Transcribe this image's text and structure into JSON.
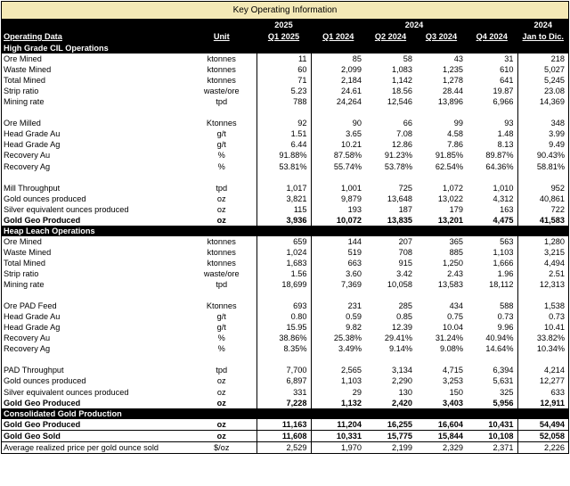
{
  "title": "Key Operating Information",
  "header": {
    "years": {
      "y2025": "2025",
      "y2024": "2024",
      "y2024b": "2024"
    },
    "col_operating": "Operating Data",
    "col_unit": "Unit",
    "periods": [
      "Q1 2025",
      "Q1 2024",
      "Q2 2024",
      "Q3 2024",
      "Q4 2024",
      "Jan to Dic."
    ]
  },
  "sections": [
    {
      "title": "High Grade CIL Operations",
      "rows": [
        {
          "label": "Ore Mined",
          "unit": "ktonnes",
          "values": [
            "11",
            "85",
            "58",
            "43",
            "31",
            "218"
          ]
        },
        {
          "label": "Waste Mined",
          "unit": "ktonnes",
          "values": [
            "60",
            "2,099",
            "1,083",
            "1,235",
            "610",
            "5,027"
          ]
        },
        {
          "label": "Total Mined",
          "unit": "ktonnes",
          "values": [
            "71",
            "2,184",
            "1,142",
            "1,278",
            "641",
            "5,245"
          ]
        },
        {
          "label": "Strip ratio",
          "unit": "waste/ore",
          "values": [
            "5.23",
            "24.61",
            "18.56",
            "28.44",
            "19.87",
            "23.08"
          ]
        },
        {
          "label": "Mining rate",
          "unit": "tpd",
          "values": [
            "788",
            "24,264",
            "12,546",
            "13,896",
            "6,966",
            "14,369"
          ]
        },
        {
          "blank": true
        },
        {
          "label": "Ore Milled",
          "unit": "Ktonnes",
          "values": [
            "92",
            "90",
            "66",
            "99",
            "93",
            "348"
          ]
        },
        {
          "label": "Head Grade Au",
          "unit": "g/t",
          "values": [
            "1.51",
            "3.65",
            "7.08",
            "4.58",
            "1.48",
            "3.99"
          ]
        },
        {
          "label": "Head Grade Ag",
          "unit": "g/t",
          "values": [
            "6.44",
            "10.21",
            "12.86",
            "7.86",
            "8.13",
            "9.49"
          ]
        },
        {
          "label": "Recovery Au",
          "unit": "%",
          "values": [
            "91.88%",
            "87.58%",
            "91.23%",
            "91.85%",
            "89.87%",
            "90.43%"
          ]
        },
        {
          "label": "Recovery Ag",
          "unit": "%",
          "values": [
            "53.81%",
            "55.74%",
            "53.78%",
            "62.54%",
            "64.36%",
            "58.81%"
          ]
        },
        {
          "blank": true
        },
        {
          "label": "Mill Throughput",
          "unit": "tpd",
          "values": [
            "1,017",
            "1,001",
            "725",
            "1,072",
            "1,010",
            "952"
          ]
        },
        {
          "label": "Gold ounces produced",
          "unit": "oz",
          "values": [
            "3,821",
            "9,879",
            "13,648",
            "13,022",
            "4,312",
            "40,861"
          ]
        },
        {
          "label": "Silver equivalent ounces produced",
          "unit": "oz",
          "values": [
            "115",
            "193",
            "187",
            "179",
            "163",
            "722"
          ]
        },
        {
          "label": "Gold Geo Produced",
          "unit": "oz",
          "values": [
            "3,936",
            "10,072",
            "13,835",
            "13,201",
            "4,475",
            "41,583"
          ],
          "bold": true
        }
      ]
    },
    {
      "title": "Heap Leach Operations",
      "rows": [
        {
          "label": "Ore Mined",
          "unit": "ktonnes",
          "values": [
            "659",
            "144",
            "207",
            "365",
            "563",
            "1,280"
          ]
        },
        {
          "label": "Waste Mined",
          "unit": "ktonnes",
          "values": [
            "1,024",
            "519",
            "708",
            "885",
            "1,103",
            "3,215"
          ]
        },
        {
          "label": "Total Mined",
          "unit": "ktonnes",
          "values": [
            "1,683",
            "663",
            "915",
            "1,250",
            "1,666",
            "4,494"
          ]
        },
        {
          "label": "Strip ratio",
          "unit": "waste/ore",
          "values": [
            "1.56",
            "3.60",
            "3.42",
            "2.43",
            "1.96",
            "2.51"
          ]
        },
        {
          "label": "Mining rate",
          "unit": "tpd",
          "values": [
            "18,699",
            "7,369",
            "10,058",
            "13,583",
            "18,112",
            "12,313"
          ]
        },
        {
          "blank": true
        },
        {
          "label": "Ore PAD Feed",
          "unit": "Ktonnes",
          "values": [
            "693",
            "231",
            "285",
            "434",
            "588",
            "1,538"
          ]
        },
        {
          "label": "Head Grade Au",
          "unit": "g/t",
          "values": [
            "0.80",
            "0.59",
            "0.85",
            "0.75",
            "0.73",
            "0.73"
          ]
        },
        {
          "label": "Head Grade Ag",
          "unit": "g/t",
          "values": [
            "15.95",
            "9.82",
            "12.39",
            "10.04",
            "9.96",
            "10.41"
          ]
        },
        {
          "label": "Recovery Au",
          "unit": "%",
          "values": [
            "38.86%",
            "25.38%",
            "29.41%",
            "31.24%",
            "40.94%",
            "33.82%"
          ]
        },
        {
          "label": "Recovery Ag",
          "unit": "%",
          "values": [
            "8.35%",
            "3.49%",
            "9.14%",
            "9.08%",
            "14.64%",
            "10.34%"
          ]
        },
        {
          "blank": true
        },
        {
          "label": "PAD Throughput",
          "unit": "tpd",
          "values": [
            "7,700",
            "2,565",
            "3,134",
            "4,715",
            "6,394",
            "4,214"
          ]
        },
        {
          "label": "Gold ounces produced",
          "unit": "oz",
          "values": [
            "6,897",
            "1,103",
            "2,290",
            "3,253",
            "5,631",
            "12,277"
          ]
        },
        {
          "label": "Silver equivalent ounces produced",
          "unit": "oz",
          "values": [
            "331",
            "29",
            "130",
            "150",
            "325",
            "633"
          ]
        },
        {
          "label": "Gold Geo Produced",
          "unit": "oz",
          "values": [
            "7,228",
            "1,132",
            "2,420",
            "3,403",
            "5,956",
            "12,911"
          ],
          "bold": true
        }
      ]
    },
    {
      "title": "Consolidated Gold Production",
      "rows": [
        {
          "label": "Gold Geo Produced",
          "unit": "oz",
          "values": [
            "11,163",
            "11,204",
            "16,255",
            "16,604",
            "10,431",
            "54,494"
          ],
          "bold": true,
          "rule": true
        },
        {
          "label": "Gold Geo Sold",
          "unit": "oz",
          "values": [
            "11,608",
            "10,331",
            "15,775",
            "15,844",
            "10,108",
            "52,058"
          ],
          "bold": true,
          "rule": true
        },
        {
          "label": "Average realized price per gold ounce sold",
          "unit": "$/oz",
          "values": [
            "2,529",
            "1,970",
            "2,199",
            "2,329",
            "2,371",
            "2,226"
          ]
        }
      ]
    }
  ]
}
